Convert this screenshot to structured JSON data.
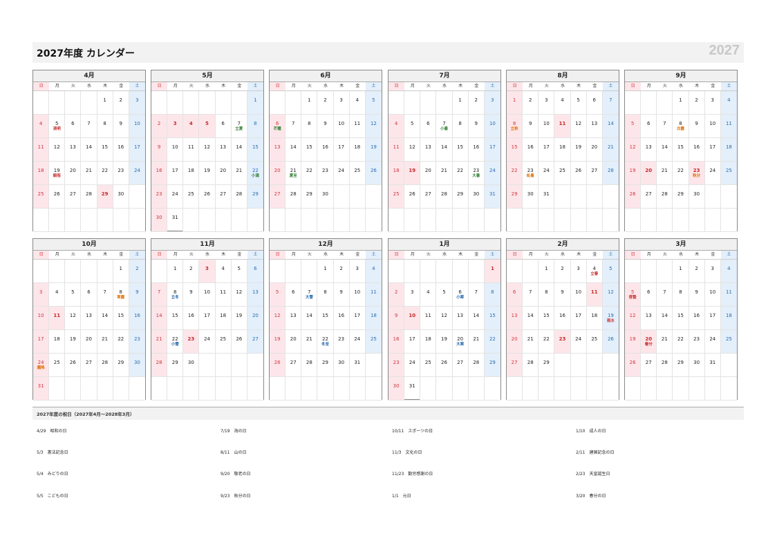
{
  "header": {
    "title": "2027年度 カレンダー",
    "year": "2027"
  },
  "weekdays": [
    "日",
    "月",
    "火",
    "水",
    "木",
    "金",
    "土"
  ],
  "months": [
    {
      "name": "4月",
      "cells": [
        "",
        "",
        "",
        "",
        "1",
        "2",
        "3",
        "4",
        "5",
        "6",
        "7",
        "8",
        "9",
        "10",
        "11",
        "12",
        "13",
        "14",
        "15",
        "16",
        "17",
        "18",
        "19",
        "20",
        "21",
        "22",
        "23",
        "24",
        "25",
        "26",
        "27",
        "28",
        "29",
        "30",
        "",
        "",
        "",
        "",
        "",
        "",
        "",
        ""
      ],
      "subs": {
        "8": {
          "t": "清明",
          "c": "red"
        },
        "22": {
          "t": "穀雨",
          "c": "red"
        }
      },
      "hol": [
        29
      ]
    },
    {
      "name": "5月",
      "cells": [
        "",
        "",
        "",
        "",
        "",
        "",
        "1",
        "2",
        "3",
        "4",
        "5",
        "6",
        "7",
        "8",
        "9",
        "10",
        "11",
        "12",
        "13",
        "14",
        "15",
        "16",
        "17",
        "18",
        "19",
        "20",
        "21",
        "22",
        "23",
        "24",
        "25",
        "26",
        "27",
        "28",
        "29",
        "30",
        "31",
        "",
        "",
        "",
        "",
        ""
      ],
      "subs": {
        "12": {
          "t": "立夏",
          "c": "green"
        },
        "27": {
          "t": "小満",
          "c": "green"
        }
      },
      "hol": [
        3,
        4,
        5
      ]
    },
    {
      "name": "6月",
      "cells": [
        "",
        "",
        "1",
        "2",
        "3",
        "4",
        "5",
        "6",
        "7",
        "8",
        "9",
        "10",
        "11",
        "12",
        "13",
        "14",
        "15",
        "16",
        "17",
        "18",
        "19",
        "20",
        "21",
        "22",
        "23",
        "24",
        "25",
        "26",
        "27",
        "28",
        "29",
        "30",
        "",
        "",
        "",
        "",
        "",
        "",
        "",
        "",
        "",
        ""
      ],
      "subs": {
        "7": {
          "t": "芒種",
          "c": "green"
        },
        "22": {
          "t": "夏至",
          "c": "green"
        }
      },
      "hol": []
    },
    {
      "name": "7月",
      "cells": [
        "",
        "",
        "",
        "",
        "1",
        "2",
        "3",
        "4",
        "5",
        "6",
        "7",
        "8",
        "9",
        "10",
        "11",
        "12",
        "13",
        "14",
        "15",
        "16",
        "17",
        "18",
        "19",
        "20",
        "21",
        "22",
        "23",
        "24",
        "25",
        "26",
        "27",
        "28",
        "29",
        "30",
        "31",
        "",
        "",
        "",
        "",
        "",
        "",
        ""
      ],
      "subs": {
        "10": {
          "t": "小暑",
          "c": "green"
        },
        "26": {
          "t": "大暑",
          "c": "green"
        }
      },
      "hol": [
        19
      ]
    },
    {
      "name": "8月",
      "cells": [
        "1",
        "2",
        "3",
        "4",
        "5",
        "6",
        "7",
        "8",
        "9",
        "10",
        "11",
        "12",
        "13",
        "14",
        "15",
        "16",
        "17",
        "18",
        "19",
        "20",
        "21",
        "22",
        "23",
        "24",
        "25",
        "26",
        "27",
        "28",
        "29",
        "30",
        "31",
        "",
        "",
        "",
        "",
        "",
        "",
        "",
        "",
        "",
        "",
        ""
      ],
      "subs": {
        "7": {
          "t": "立秋",
          "c": "orange"
        },
        "22": {
          "t": "処暑",
          "c": "orange"
        }
      },
      "hol": [
        11
      ]
    },
    {
      "name": "9月",
      "cells": [
        "",
        "",
        "",
        "1",
        "2",
        "3",
        "4",
        "5",
        "6",
        "7",
        "8",
        "9",
        "10",
        "11",
        "12",
        "13",
        "14",
        "15",
        "16",
        "17",
        "18",
        "19",
        "20",
        "21",
        "22",
        "23",
        "24",
        "25",
        "26",
        "27",
        "28",
        "29",
        "30",
        "",
        "",
        "",
        "",
        "",
        "",
        "",
        "",
        ""
      ],
      "subs": {
        "10": {
          "t": "白露",
          "c": "orange"
        },
        "25": {
          "t": "秋分",
          "c": "orange"
        }
      },
      "hol": [
        20,
        23
      ]
    },
    {
      "name": "10月",
      "cells": [
        "",
        "",
        "",
        "",
        "",
        "1",
        "2",
        "3",
        "4",
        "5",
        "6",
        "7",
        "8",
        "9",
        "10",
        "11",
        "12",
        "13",
        "14",
        "15",
        "16",
        "17",
        "18",
        "19",
        "20",
        "21",
        "22",
        "23",
        "24",
        "25",
        "26",
        "27",
        "28",
        "29",
        "30",
        "31",
        "",
        "",
        "",
        "",
        "",
        ""
      ],
      "subs": {
        "12": {
          "t": "寒露",
          "c": "orange"
        },
        "28": {
          "t": "霜降",
          "c": "orange"
        }
      },
      "hol": [
        11
      ]
    },
    {
      "name": "11月",
      "cells": [
        "",
        "1",
        "2",
        "3",
        "4",
        "5",
        "6",
        "7",
        "8",
        "9",
        "10",
        "11",
        "12",
        "13",
        "14",
        "15",
        "16",
        "17",
        "18",
        "19",
        "20",
        "21",
        "22",
        "23",
        "24",
        "25",
        "26",
        "27",
        "28",
        "29",
        "30",
        "",
        "",
        "",
        "",
        "",
        "",
        "",
        "",
        "",
        "",
        ""
      ],
      "subs": {
        "8": {
          "t": "立冬",
          "c": "blue"
        },
        "22": {
          "t": "小雪",
          "c": "blue"
        }
      },
      "hol": [
        3,
        23
      ]
    },
    {
      "name": "12月",
      "cells": [
        "",
        "",
        "",
        "1",
        "2",
        "3",
        "4",
        "5",
        "6",
        "7",
        "8",
        "9",
        "10",
        "11",
        "12",
        "13",
        "14",
        "15",
        "16",
        "17",
        "18",
        "19",
        "20",
        "21",
        "22",
        "23",
        "24",
        "25",
        "26",
        "27",
        "28",
        "29",
        "30",
        "31",
        "",
        "",
        "",
        "",
        "",
        "",
        "",
        ""
      ],
      "subs": {
        "9": {
          "t": "大雪",
          "c": "blue"
        },
        "24": {
          "t": "冬至",
          "c": "blue"
        }
      },
      "hol": []
    },
    {
      "name": "1月",
      "cells": [
        "",
        "",
        "",
        "",
        "",
        "",
        "1",
        "2",
        "3",
        "4",
        "5",
        "6",
        "7",
        "8",
        "9",
        "10",
        "11",
        "12",
        "13",
        "14",
        "15",
        "16",
        "17",
        "18",
        "19",
        "20",
        "21",
        "22",
        "23",
        "24",
        "25",
        "26",
        "27",
        "28",
        "29",
        "30",
        "31",
        "",
        "",
        "",
        "",
        ""
      ],
      "subs": {
        "11": {
          "t": "小寒",
          "c": "blue"
        },
        "25": {
          "t": "大寒",
          "c": "blue"
        }
      },
      "hol": [
        1,
        10
      ]
    },
    {
      "name": "2月",
      "cells": [
        "",
        "",
        "1",
        "2",
        "3",
        "4",
        "5",
        "6",
        "7",
        "8",
        "9",
        "10",
        "11",
        "12",
        "13",
        "14",
        "15",
        "16",
        "17",
        "18",
        "19",
        "20",
        "21",
        "22",
        "23",
        "24",
        "25",
        "26",
        "27",
        "28",
        "29",
        "",
        "",
        "",
        "",
        "",
        "",
        "",
        "",
        "",
        "",
        ""
      ],
      "subs": {
        "5": {
          "t": "立春",
          "c": "red"
        },
        "20": {
          "t": "雨水",
          "c": "red"
        }
      },
      "hol": [
        11,
        23
      ]
    },
    {
      "name": "3月",
      "cells": [
        "",
        "",
        "",
        "1",
        "2",
        "3",
        "4",
        "5",
        "6",
        "7",
        "8",
        "9",
        "10",
        "11",
        "12",
        "13",
        "14",
        "15",
        "16",
        "17",
        "18",
        "19",
        "20",
        "21",
        "22",
        "23",
        "24",
        "25",
        "26",
        "27",
        "28",
        "29",
        "30",
        "31",
        "",
        "",
        "",
        "",
        "",
        "",
        "",
        ""
      ],
      "subs": {
        "7": {
          "t": "啓蟄",
          "c": "red"
        },
        "22": {
          "t": "春分",
          "c": "red"
        }
      },
      "hol": [
        20
      ]
    }
  ],
  "holidays": {
    "title": "2027年度の祝日（2027年4月～2028年3月）",
    "items": [
      {
        "date": "4/29",
        "name": "昭和の日"
      },
      {
        "date": "5/3",
        "name": "憲法記念日"
      },
      {
        "date": "5/4",
        "name": "みどりの日"
      },
      {
        "date": "5/5",
        "name": "こどもの日"
      },
      {
        "date": "7/19",
        "name": "海の日"
      },
      {
        "date": "8/11",
        "name": "山の日"
      },
      {
        "date": "9/20",
        "name": "敬老の日"
      },
      {
        "date": "9/23",
        "name": "秋分の日"
      },
      {
        "date": "10/11",
        "name": "スポーツの日"
      },
      {
        "date": "11/3",
        "name": "文化の日"
      },
      {
        "date": "11/23",
        "name": "勤労感謝の日"
      },
      {
        "date": "1/1",
        "name": "元日"
      },
      {
        "date": "1/10",
        "name": "成人の日"
      },
      {
        "date": "2/11",
        "name": "建国記念の日"
      },
      {
        "date": "2/23",
        "name": "天皇誕生日"
      },
      {
        "date": "3/20",
        "name": "春分の日"
      }
    ]
  }
}
